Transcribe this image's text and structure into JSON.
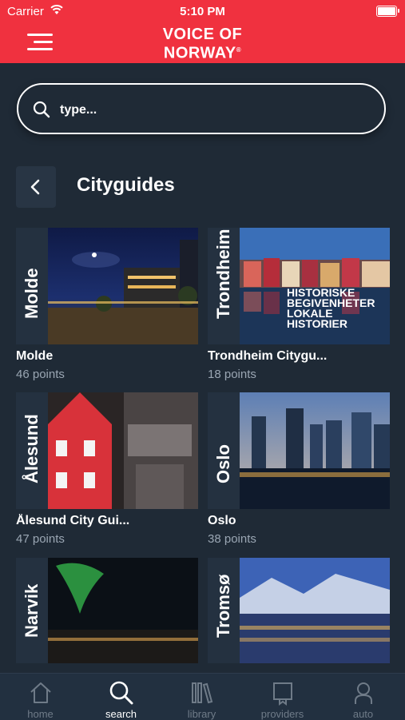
{
  "status_bar": {
    "carrier": "Carrier",
    "time": "5:10 PM"
  },
  "header": {
    "logo_line1": "VOICE OF",
    "logo_line2": "NORWAY",
    "logo_mark": "®"
  },
  "search": {
    "placeholder": "type..."
  },
  "section": {
    "title": "Cityguides"
  },
  "cities": [
    {
      "vertical_label": "Molde",
      "name": "Molde",
      "points": "46 points"
    },
    {
      "vertical_label": "Trondheim",
      "name": "Trondheim Citygu...",
      "points": "18 points",
      "overlay": [
        "HISTORISKE",
        "BEGIVENHETER",
        "LOKALE",
        "HISTORIER"
      ]
    },
    {
      "vertical_label": "Ålesund",
      "name": "Ålesund City Gui...",
      "points": "47 points"
    },
    {
      "vertical_label": "Oslo",
      "name": "Oslo",
      "points": "38 points"
    },
    {
      "vertical_label": "Narvik"
    },
    {
      "vertical_label": "Tromsø"
    }
  ],
  "tabbar": {
    "active": "search",
    "tabs": [
      {
        "label": "home",
        "icon": "home-icon"
      },
      {
        "label": "search",
        "icon": "search-icon"
      },
      {
        "label": "library",
        "icon": "library-icon"
      },
      {
        "label": "providers",
        "icon": "providers-icon"
      },
      {
        "label": "auto",
        "icon": "auto-icon"
      }
    ]
  },
  "colors": {
    "brand_red": "#f0313f",
    "background": "#1f2a36",
    "tab_inactive": "#6f7b88"
  }
}
